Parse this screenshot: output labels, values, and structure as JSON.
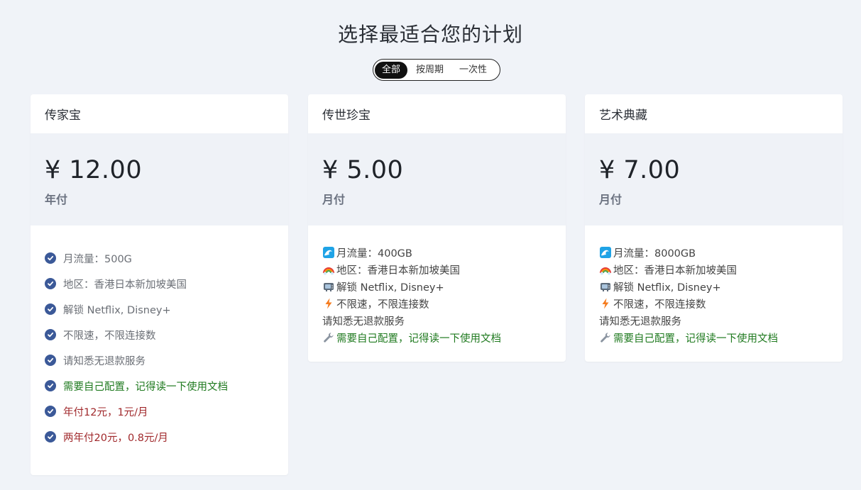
{
  "header": {
    "title": "选择最适合您的计划",
    "filter": [
      "全部",
      "按周期",
      "一次性"
    ],
    "filter_active": 0
  },
  "plans": [
    {
      "name": "传家宝",
      "price": "¥ 12.00",
      "period": "年付",
      "features": [
        {
          "text": "月流量：500G",
          "color": "default"
        },
        {
          "text": "地区：香港日本新加坡美国",
          "color": "default"
        },
        {
          "text": "解锁 Netflix, Disney+",
          "color": "default"
        },
        {
          "text": "不限速，不限连接数",
          "color": "default"
        },
        {
          "text": "请知悉无退款服务",
          "color": "default"
        },
        {
          "text": "需要自己配置，记得读一下使用文档",
          "color": "green"
        },
        {
          "text": "年付12元，1元/月",
          "color": "red"
        },
        {
          "text": "两年付20元，0.8元/月",
          "color": "red"
        }
      ]
    },
    {
      "name": "传世珍宝",
      "price": "¥ 5.00",
      "period": "月付",
      "lines": [
        {
          "icon": "wave-icon",
          "text": "月流量：400GB"
        },
        {
          "icon": "rainbow-icon",
          "text": "地区：香港日本新加坡美国"
        },
        {
          "icon": "tv-icon",
          "text": "解锁 Netflix, Disney+"
        },
        {
          "icon": "lightning-icon",
          "text": "不限速，不限连接数"
        },
        {
          "icon": "",
          "text": "请知悉无退款服务"
        },
        {
          "icon": "wrench-icon",
          "text": "需要自己配置，记得读一下使用文档"
        }
      ]
    },
    {
      "name": "艺术典藏",
      "price": "¥ 7.00",
      "period": "月付",
      "lines": [
        {
          "icon": "wave-icon",
          "text": "月流量：8000GB"
        },
        {
          "icon": "rainbow-icon",
          "text": "地区：香港日本新加坡美国"
        },
        {
          "icon": "tv-icon",
          "text": "解锁 Netflix, Disney+"
        },
        {
          "icon": "lightning-icon",
          "text": "不限速，不限连接数"
        },
        {
          "icon": "",
          "text": "请知悉无退款服务"
        },
        {
          "icon": "wrench-icon",
          "text": "需要自己配置，记得读一下使用文档"
        }
      ]
    }
  ],
  "colors": {
    "background": "#f0f3f8",
    "check": "#3b5998",
    "green": "#1f7a1f",
    "red": "#a0282b",
    "filter_active": "#111111"
  }
}
